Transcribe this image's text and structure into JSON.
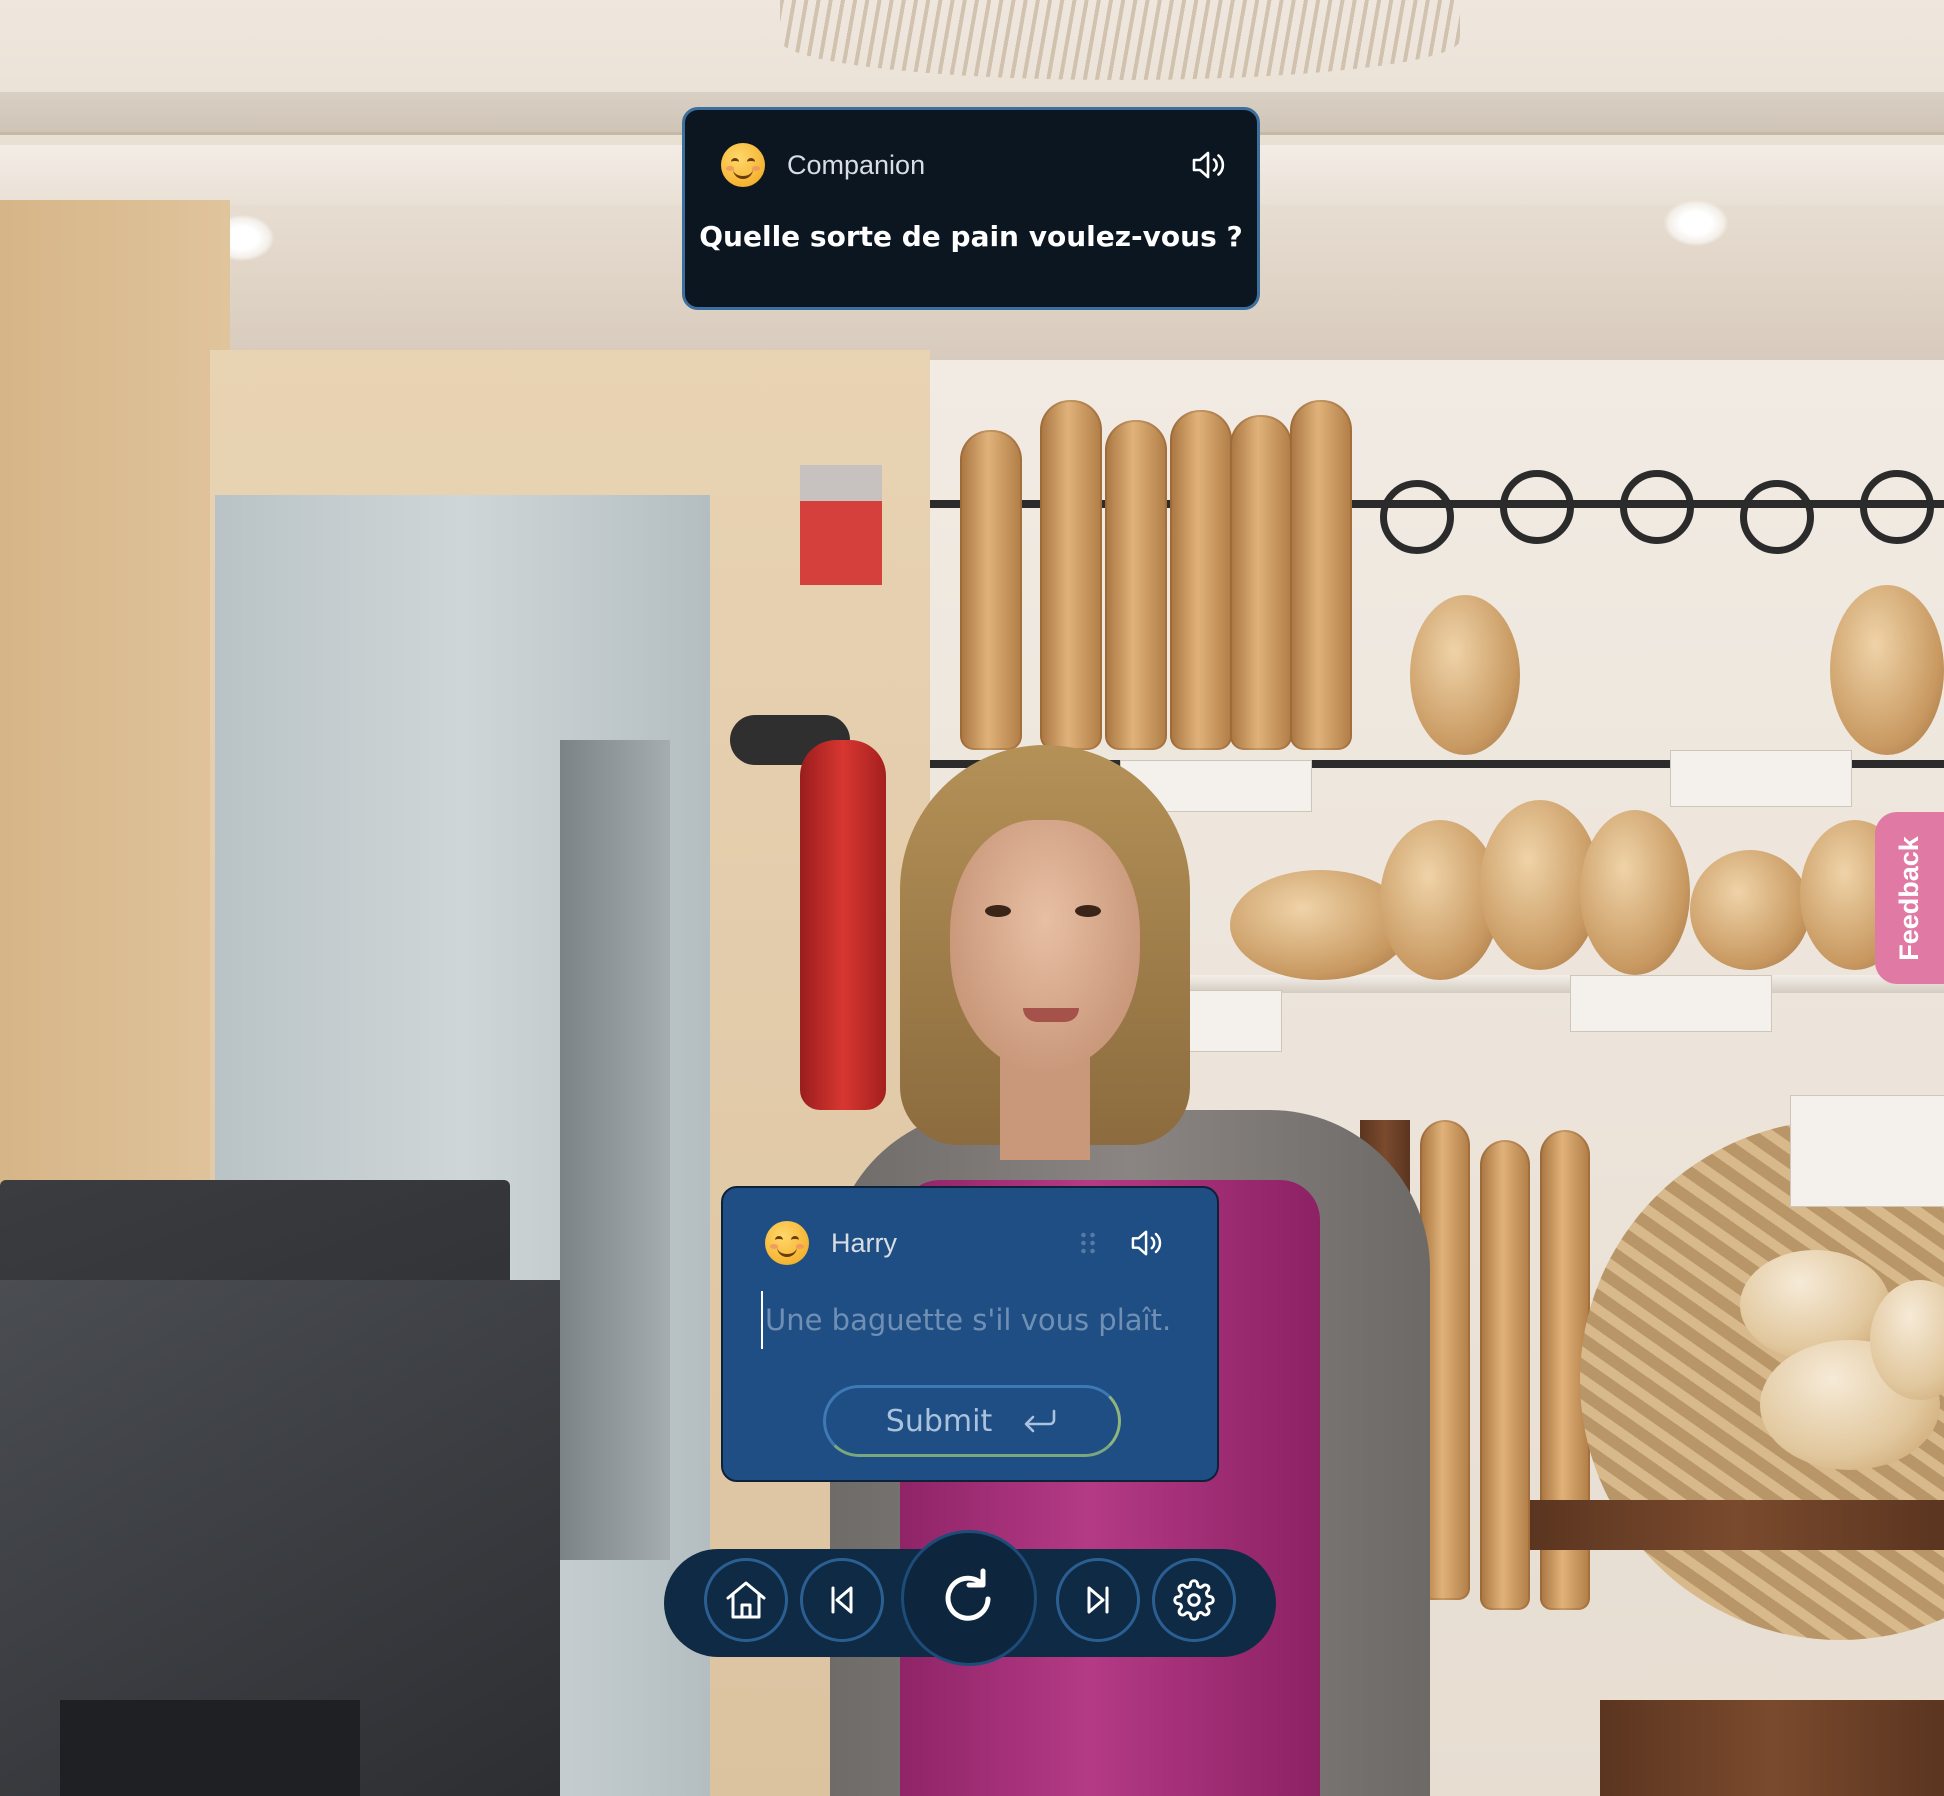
{
  "companion": {
    "name": "Companion",
    "message": "Quelle sorte de pain voulez-vous ?",
    "avatar_icon": "smiling-face-icon",
    "audio_icon": "speaker-icon"
  },
  "user": {
    "name": "Harry",
    "avatar_icon": "smiling-face-icon",
    "input_value": "",
    "input_placeholder": "Une baguette s'il vous plaît.",
    "submit_label": "Submit",
    "submit_icon": "enter-arrow-icon"
  },
  "controls": [
    {
      "name": "home",
      "icon": "home-icon"
    },
    {
      "name": "previous",
      "icon": "skip-back-icon"
    },
    {
      "name": "restart",
      "icon": "restart-icon"
    },
    {
      "name": "next",
      "icon": "skip-forward-icon"
    },
    {
      "name": "settings",
      "icon": "gear-icon"
    }
  ],
  "feedback": {
    "label": "Feedback"
  },
  "colors": {
    "companion_card_bg": "#0c1620",
    "user_card_bg": "#1f4e85",
    "control_bar_bg": "#0f2a44",
    "feedback_bg": "#e07aa5"
  }
}
